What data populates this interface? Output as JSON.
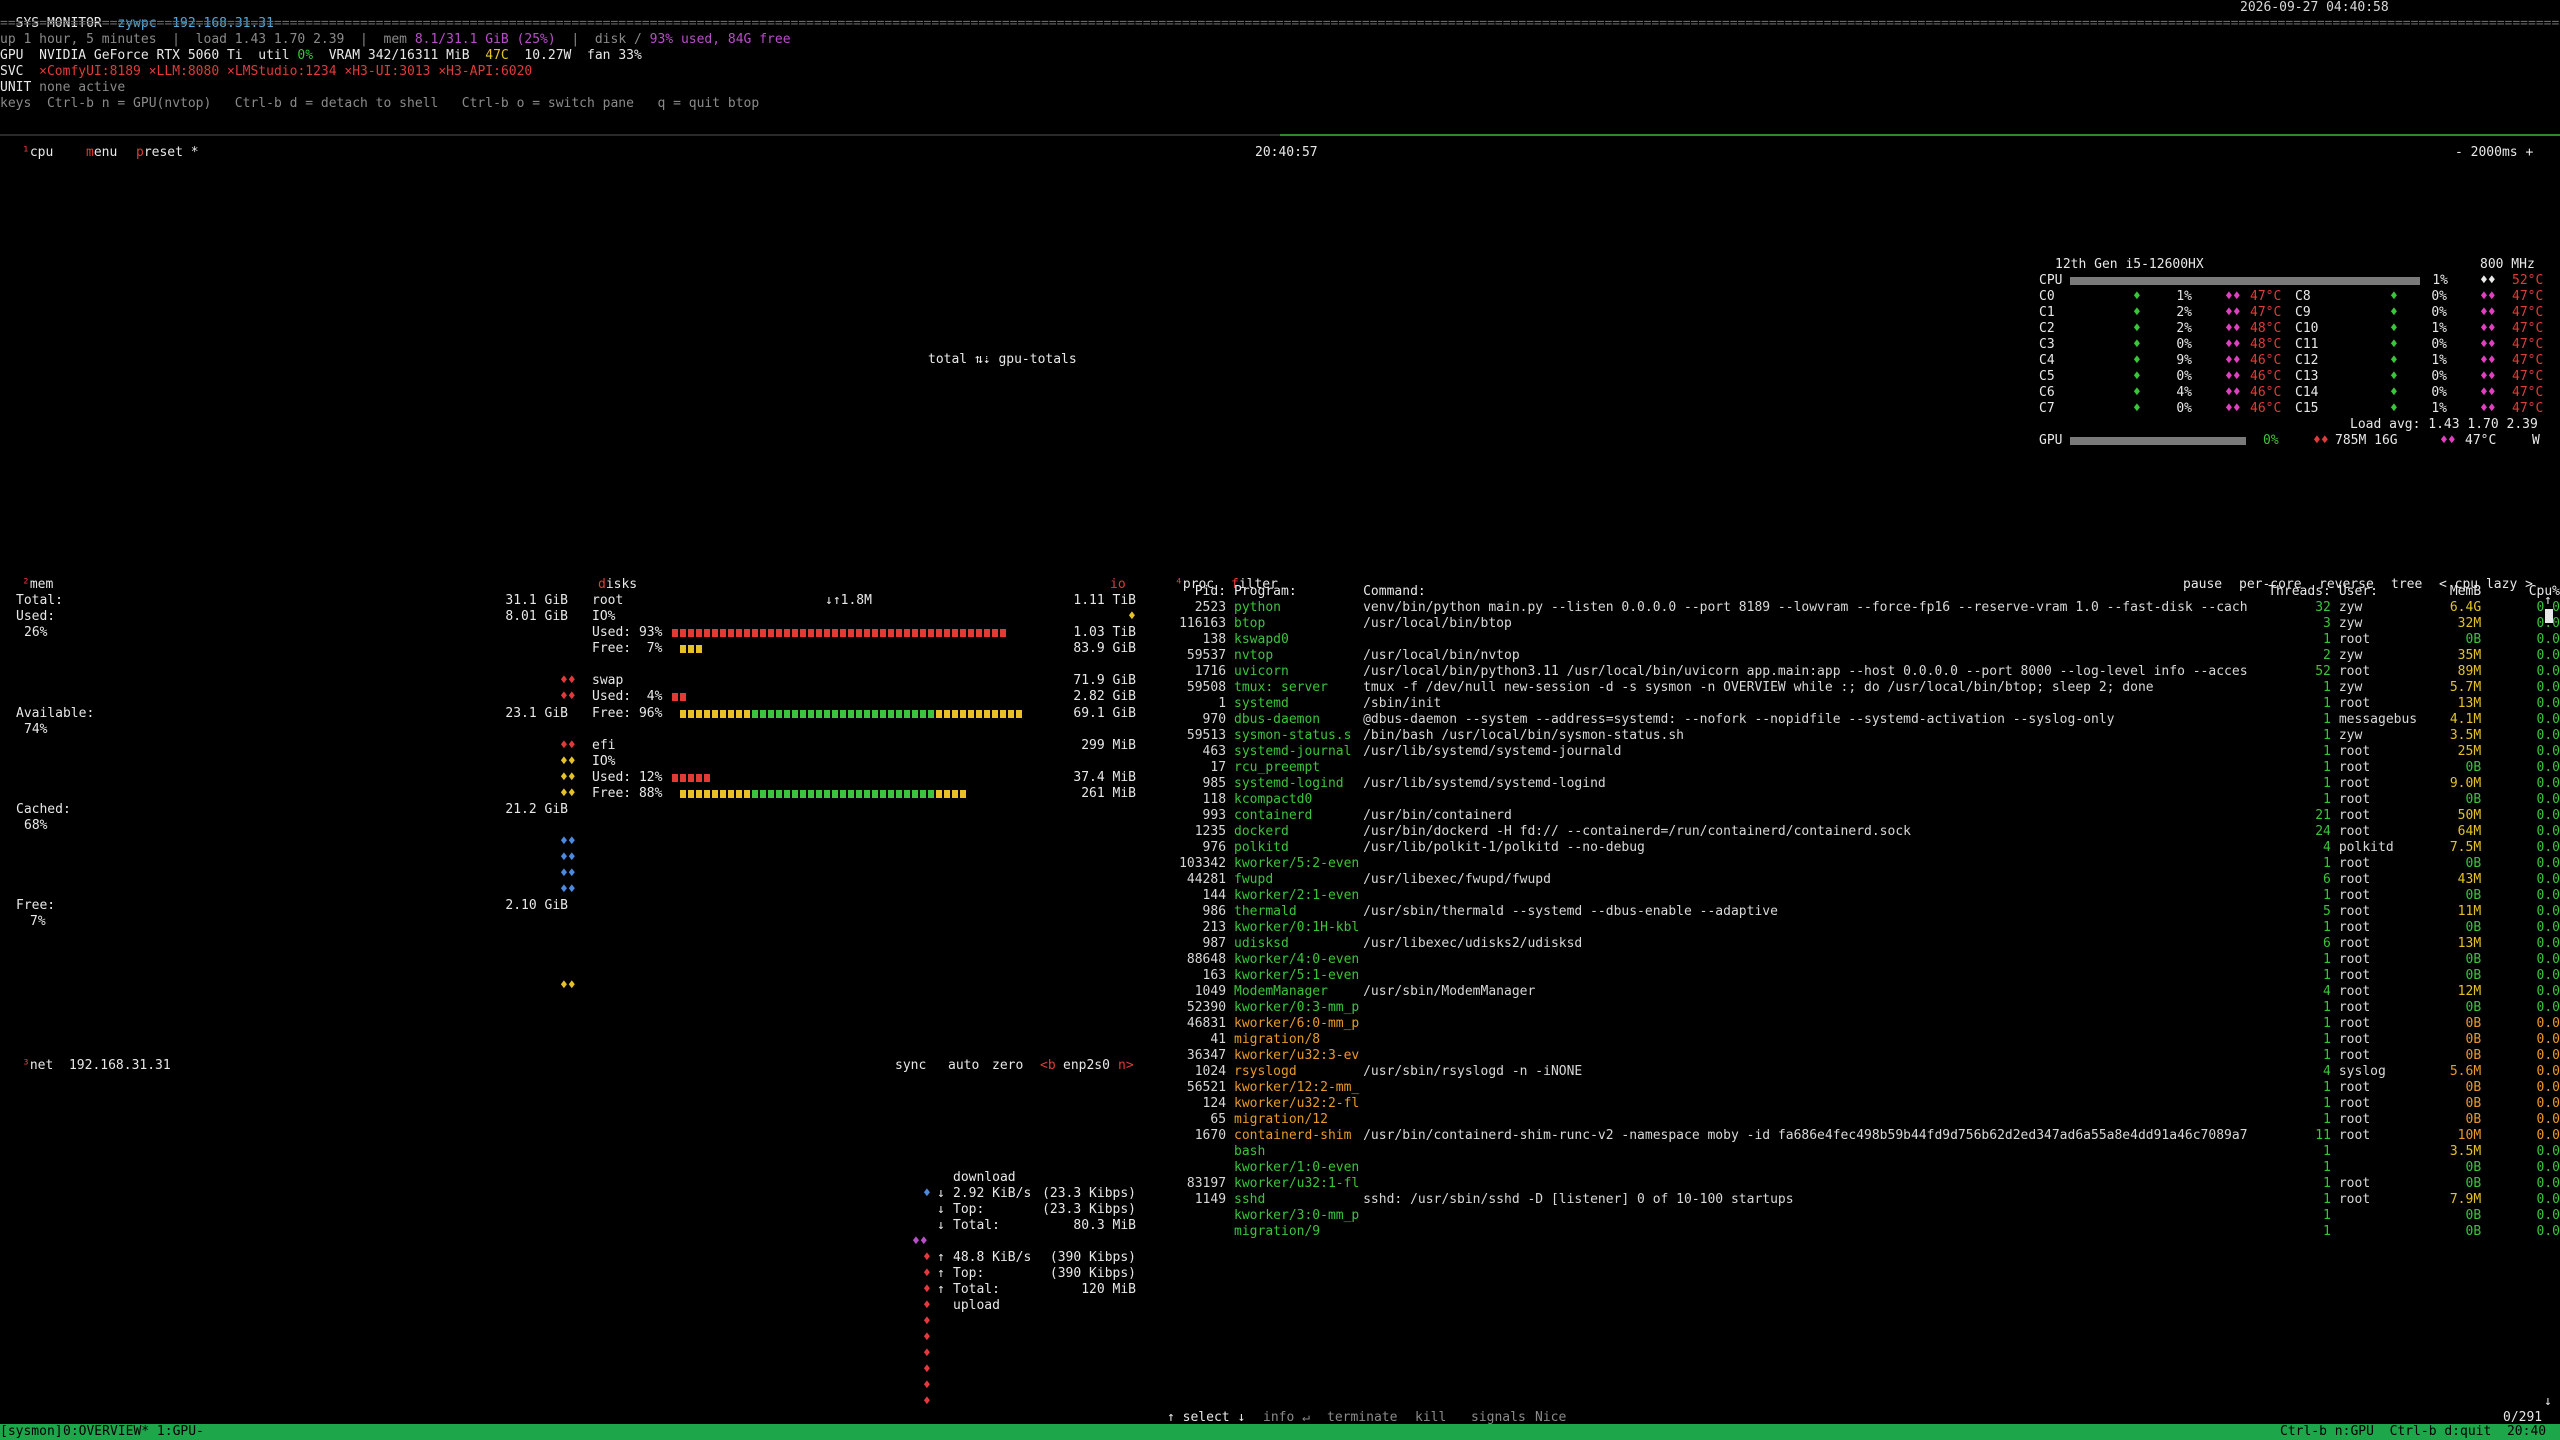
{
  "header": {
    "title": "SYS MONITOR",
    "host": "zywpc",
    "ip": "192.168.31.31",
    "datetime": "2026-09-27 04:40:58",
    "rule": "=====================================================================================================================================================================================================================================================================================================================================================================================================================",
    "uptime": "up 1 hour, 5 minutes  |  load 1.43 1.70 2.39  |  mem ",
    "mem_val": "8.1/31.1 GiB (25%)",
    "disk_sep": "  |  disk / ",
    "disk_val": "93% used, 84G free",
    "gpu_prefix": "GPU  NVIDIA GeForce RTX 5060 Ti  util ",
    "gpu_util": "0%",
    "gpu_mid": "  VRAM 342/16311 MiB  ",
    "gpu_temp": "47C",
    "gpu_tail": "  10.27W  fan 33%",
    "svc_label": "SVC",
    "svc_items": [
      "×ComfyUI:8189",
      "×LLM:8080",
      "×LMStudio:1234",
      "×H3-UI:3013",
      "×H3-API:6020"
    ],
    "unit_label": "UNIT",
    "unit_val": "none active",
    "keys_label": "keys",
    "keys_val": "  Ctrl-b n = GPU(nvtop)   Ctrl-b d = detach to shell   Ctrl-b o = switch pane   q = quit btop"
  },
  "btop_top": {
    "cpu_tab": "cpu",
    "cpu_tab_key": "¹",
    "menu_m": "m",
    "menu_rest": "enu",
    "preset_p": "p",
    "preset_rest": "reset *",
    "clock": "20:40:57",
    "interval": "- 2000ms +",
    "gpu_totals": "total ⇅⇣ gpu-totals"
  },
  "cpu_box": {
    "model": "12th Gen i5-12600HX",
    "freq": "800 MHz",
    "total_label": "CPU",
    "total_pct": "1%",
    "total_temp": "52°C",
    "cores": [
      {
        "l": "C0",
        "p": "1%",
        "t": "47°C",
        "r": "C8",
        "rp": "0%",
        "rt": "47°C"
      },
      {
        "l": "C1",
        "p": "2%",
        "t": "47°C",
        "r": "C9",
        "rp": "0%",
        "rt": "47°C"
      },
      {
        "l": "C2",
        "p": "2%",
        "t": "48°C",
        "r": "C10",
        "rp": "1%",
        "rt": "47°C"
      },
      {
        "l": "C3",
        "p": "0%",
        "t": "48°C",
        "r": "C11",
        "rp": "0%",
        "rt": "47°C"
      },
      {
        "l": "C4",
        "p": "9%",
        "t": "46°C",
        "r": "C12",
        "rp": "1%",
        "rt": "47°C"
      },
      {
        "l": "C5",
        "p": "0%",
        "t": "46°C",
        "r": "C13",
        "rp": "0%",
        "rt": "47°C"
      },
      {
        "l": "C6",
        "p": "4%",
        "t": "46°C",
        "r": "C14",
        "rp": "0%",
        "rt": "47°C"
      },
      {
        "l": "C7",
        "p": "0%",
        "t": "46°C",
        "r": "C15",
        "rp": "1%",
        "rt": "47°C"
      }
    ],
    "load": "Load avg: 1.43 1.70 2.39",
    "gpu_label": "GPU",
    "gpu_pct": "0%",
    "gpu_mem": "785M 16G",
    "gpu_temp": "47°C",
    "gpu_w": "W"
  },
  "mem": {
    "title_key": "²",
    "title": "mem",
    "total_label": "Total:",
    "total_val": "31.1 GiB",
    "used_label": "Used:",
    "used_val": "8.01 GiB",
    "used_pct": "26%",
    "avail_label": "Available:",
    "avail_val": "23.1 GiB",
    "avail_pct": "74%",
    "cached_label": "Cached:",
    "cached_val": "21.2 GiB",
    "cached_pct": "68%",
    "free_label": "Free:",
    "free_val": "2.10 GiB",
    "free_pct": "7%"
  },
  "disks": {
    "title_d": "d",
    "title_rest": "isks",
    "io_rate": "↓↑1.8M",
    "io_label": "io",
    "root": {
      "name": "root",
      "total": "1.11 TiB",
      "io": "IO%",
      "used": "Used: 93%",
      "used_val": "1.03 TiB",
      "free": "Free:  7%",
      "free_val": "83.9 GiB",
      "used_frac": 0.93,
      "free_frac": 0.07
    },
    "swap": {
      "name": "swap",
      "total": "71.9 GiB",
      "used": "Used:  4%",
      "used_val": "2.82 GiB",
      "free": "Free: 96%",
      "free_val": "69.1 GiB",
      "used_frac": 0.04,
      "free_frac": 0.96
    },
    "efi": {
      "name": "efi",
      "total": "299 MiB",
      "io": "IO%",
      "used": "Used: 12%",
      "used_val": "37.4 MiB",
      "free": "Free: 88%",
      "free_val": "261 MiB",
      "used_frac": 0.12,
      "free_frac": 0.88
    }
  },
  "net": {
    "title_key": "³",
    "title": "net",
    "ip": "192.168.31.31",
    "sync": "sync",
    "auto": "auto",
    "zero": "zero",
    "b": "<b",
    "iface": "enp2s0",
    "n": "n>",
    "download_label": "download",
    "dl_rate": "2.92 KiB/s",
    "dl_kbps": "(23.3 Kibps)",
    "dl_top_label": "Top:",
    "dl_top": "(23.3 Kibps)",
    "dl_total_label": "Total:",
    "dl_total": "80.3 MiB",
    "ul_rate": "48.8 KiB/s",
    "ul_kbps": "(390 Kibps)",
    "ul_top_label": "Top:",
    "ul_top": "(390 Kibps)",
    "ul_total_label": "Total:",
    "ul_total": "120 MiB",
    "upload_label": "upload"
  },
  "proc": {
    "title_key": "⁴",
    "title": "proc",
    "filter_f": "f",
    "filter_rest": "ilter",
    "pause": "pause",
    "per_core": "per-core",
    "reverse": "reverse",
    "tree": "tree",
    "sort": "< cpu lazy >",
    "headers": {
      "pid": "Pid:",
      "prog": "Program:",
      "cmd": "Command:",
      "thr": "Threads:",
      "user": "User:",
      "mem": "MemB",
      "cpu": "Cpu%"
    },
    "rows": [
      [
        "2523",
        "python",
        "venv/bin/python main.py --listen 0.0.0.0 --port 8189 --lowvram --force-fp16 --reserve-vram 1.0 --fast-disk --cach",
        "32",
        "zyw",
        "6.4G",
        "0.0"
      ],
      [
        "116163",
        "btop",
        "/usr/local/bin/btop",
        "3",
        "zyw",
        "32M",
        "0.0"
      ],
      [
        "138",
        "kswapd0",
        "",
        "1",
        "root",
        "0B",
        "0.0"
      ],
      [
        "59537",
        "nvtop",
        "/usr/local/bin/nvtop",
        "2",
        "zyw",
        "35M",
        "0.0"
      ],
      [
        "1716",
        "uvicorn",
        "/usr/local/bin/python3.11 /usr/local/bin/uvicorn app.main:app --host 0.0.0.0 --port 8000 --log-level info --acces",
        "52",
        "root",
        "89M",
        "0.0"
      ],
      [
        "59508",
        "tmux: server",
        "tmux -f /dev/null new-session -d -s sysmon -n OVERVIEW while :; do /usr/local/bin/btop; sleep 2; done",
        "1",
        "zyw",
        "5.7M",
        "0.0"
      ],
      [
        "1",
        "systemd",
        "/sbin/init",
        "1",
        "root",
        "13M",
        "0.0"
      ],
      [
        "970",
        "dbus-daemon",
        "@dbus-daemon --system --address=systemd: --nofork --nopidfile --systemd-activation --syslog-only",
        "1",
        "messagebus",
        "4.1M",
        "0.0"
      ],
      [
        "59513",
        "sysmon-status.s",
        "/bin/bash /usr/local/bin/sysmon-status.sh",
        "1",
        "zyw",
        "3.5M",
        "0.0"
      ],
      [
        "463",
        "systemd-journal",
        "/usr/lib/systemd/systemd-journald",
        "1",
        "root",
        "25M",
        "0.0"
      ],
      [
        "17",
        "rcu_preempt",
        "",
        "1",
        "root",
        "0B",
        "0.0"
      ],
      [
        "985",
        "systemd-logind",
        "/usr/lib/systemd/systemd-logind",
        "1",
        "root",
        "9.0M",
        "0.0"
      ],
      [
        "118",
        "kcompactd0",
        "",
        "1",
        "root",
        "0B",
        "0.0"
      ],
      [
        "993",
        "containerd",
        "/usr/bin/containerd",
        "21",
        "root",
        "50M",
        "0.0"
      ],
      [
        "1235",
        "dockerd",
        "/usr/bin/dockerd -H fd:// --containerd=/run/containerd/containerd.sock",
        "24",
        "root",
        "64M",
        "0.0"
      ],
      [
        "976",
        "polkitd",
        "/usr/lib/polkit-1/polkitd --no-debug",
        "4",
        "polkitd",
        "7.5M",
        "0.0"
      ],
      [
        "103342",
        "kworker/5:2-even",
        "",
        "1",
        "root",
        "0B",
        "0.0"
      ],
      [
        "44281",
        "fwupd",
        "/usr/libexec/fwupd/fwupd",
        "6",
        "root",
        "43M",
        "0.0"
      ],
      [
        "144",
        "kworker/2:1-even",
        "",
        "1",
        "root",
        "0B",
        "0.0"
      ],
      [
        "986",
        "thermald",
        "/usr/sbin/thermald --systemd --dbus-enable --adaptive",
        "5",
        "root",
        "11M",
        "0.0"
      ],
      [
        "213",
        "kworker/0:1H-kbl",
        "",
        "1",
        "root",
        "0B",
        "0.0"
      ],
      [
        "987",
        "udisksd",
        "/usr/libexec/udisks2/udisksd",
        "6",
        "root",
        "13M",
        "0.0"
      ],
      [
        "88648",
        "kworker/4:0-even",
        "",
        "1",
        "root",
        "0B",
        "0.0"
      ],
      [
        "163",
        "kworker/5:1-even",
        "",
        "1",
        "root",
        "0B",
        "0.0"
      ],
      [
        "1049",
        "ModemManager",
        "/usr/sbin/ModemManager",
        "4",
        "root",
        "12M",
        "0.0"
      ],
      [
        "52390",
        "kworker/0:3-mm_p",
        "",
        "1",
        "root",
        "0B",
        "0.0"
      ],
      [
        "46831",
        "kworker/6:0-mm_p",
        "",
        "1",
        "root",
        "0B",
        "0.0"
      ],
      [
        "41",
        "migration/8",
        "",
        "1",
        "root",
        "0B",
        "0.0"
      ],
      [
        "36347",
        "kworker/u32:3-ev",
        "",
        "1",
        "root",
        "0B",
        "0.0"
      ],
      [
        "1024",
        "rsyslogd",
        "/usr/sbin/rsyslogd -n -iNONE",
        "4",
        "syslog",
        "5.6M",
        "0.0"
      ],
      [
        "56521",
        "kworker/12:2-mm_",
        "",
        "1",
        "root",
        "0B",
        "0.0"
      ],
      [
        "124",
        "kworker/u32:2-fl",
        "",
        "1",
        "root",
        "0B",
        "0.0"
      ],
      [
        "65",
        "migration/12",
        "",
        "1",
        "root",
        "0B",
        "0.0"
      ],
      [
        "1670",
        "containerd-shim",
        "/usr/bin/containerd-shim-runc-v2 -namespace moby -id fa686e4fec498b59b44fd9d756b62d2ed347ad6a55a8e4dd91a46c7089a7",
        "11",
        "root",
        "10M",
        "0.0"
      ],
      [
        "",
        "bash",
        "",
        "1",
        "",
        "3.5M",
        "0.0"
      ],
      [
        "",
        "kworker/1:0-even",
        "",
        "1",
        "",
        "0B",
        "0.0"
      ],
      [
        "83197",
        "kworker/u32:1-fl",
        "",
        "1",
        "root",
        "0B",
        "0.0"
      ],
      [
        "1149",
        "sshd",
        "sshd: /usr/sbin/sshd -D [listener] 0 of 10-100 startups",
        "1",
        "root",
        "7.9M",
        "0.0"
      ],
      [
        "",
        "kworker/3:0-mm_p",
        "",
        "1",
        "",
        "0B",
        "0.0"
      ],
      [
        "",
        "migration/9",
        "",
        "1",
        "",
        "0B",
        "0.0"
      ]
    ],
    "footer": {
      "select": "↑ select ↓",
      "info": "info ↵",
      "terminate": "terminate",
      "kill": "kill",
      "signals": "signals",
      "nice": "Nice",
      "count": "0/291"
    }
  },
  "statusbar": {
    "session": "[sysmon]",
    "windows": "0:OVERVIEW* 1:GPU-",
    "right": "Ctrl-b n:GPU  Ctrl-b d:quit  20:40"
  }
}
